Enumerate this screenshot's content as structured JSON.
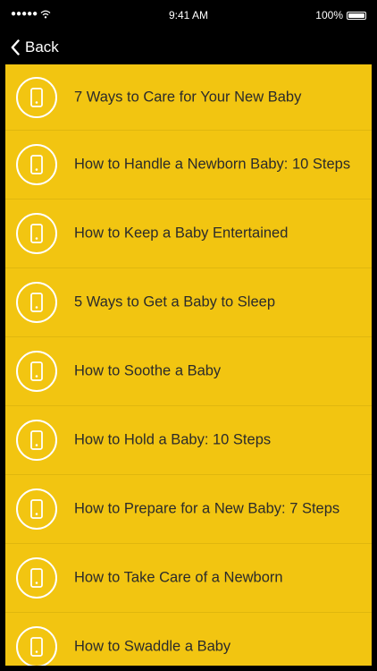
{
  "status_bar": {
    "signal": "●●●●●",
    "time": "9:41 AM",
    "battery": "100%"
  },
  "nav": {
    "back_label": "Back"
  },
  "items": [
    {
      "label": "7 Ways to Care for Your New Baby"
    },
    {
      "label": "How to Handle a Newborn Baby: 10 Steps"
    },
    {
      "label": "How to Keep a Baby Entertained"
    },
    {
      "label": "5 Ways to Get a Baby to Sleep"
    },
    {
      "label": "How to Soothe a Baby"
    },
    {
      "label": "How to Hold a Baby: 10 Steps"
    },
    {
      "label": "How to Prepare for a New Baby: 7 Steps"
    },
    {
      "label": "How to Take Care of a Newborn"
    },
    {
      "label": "How to Swaddle a Baby"
    }
  ],
  "colors": {
    "background": "#f2c511",
    "bar": "#000000",
    "text": "#2b2b2b"
  },
  "icons": {
    "back": "chevron-left-icon",
    "item": "phone-icon"
  }
}
